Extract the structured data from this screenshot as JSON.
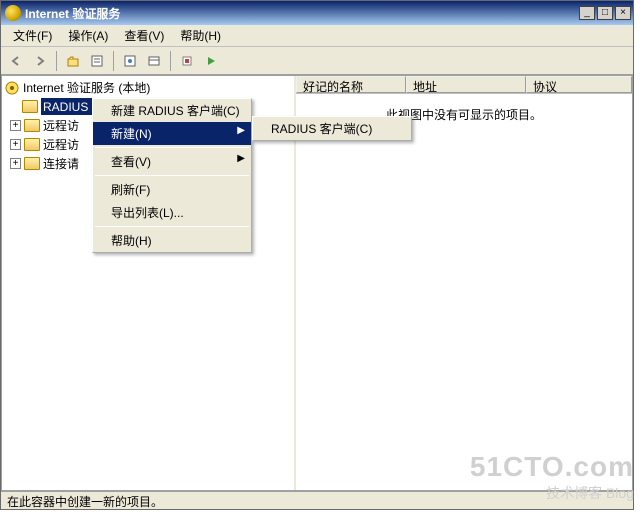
{
  "window": {
    "title": "Internet 验证服务"
  },
  "menubar": {
    "file": "文件(F)",
    "action": "操作(A)",
    "view": "查看(V)",
    "help": "帮助(H)"
  },
  "tree": {
    "root": "Internet 验证服务 (本地)",
    "selected": "RADIUS 客户端",
    "item1": "远程访",
    "item2": "远程访",
    "item3": "连接请"
  },
  "listhdr": {
    "c0": "好记的名称",
    "c1": "地址",
    "c2": "协议"
  },
  "listbody": {
    "empty": "此视图中没有可显示的项目。"
  },
  "ctx": {
    "newclient": "新建 RADIUS 客户端(C)",
    "new": "新建(N)",
    "view": "查看(V)",
    "refresh": "刷新(F)",
    "export": "导出列表(L)...",
    "help": "帮助(H)"
  },
  "submenu": {
    "radius": "RADIUS 客户端(C)"
  },
  "statusbar": {
    "text": "在此容器中创建一新的项目。"
  },
  "watermark": {
    "big": "51CTO.com",
    "sm": "技术博客  Blog"
  }
}
